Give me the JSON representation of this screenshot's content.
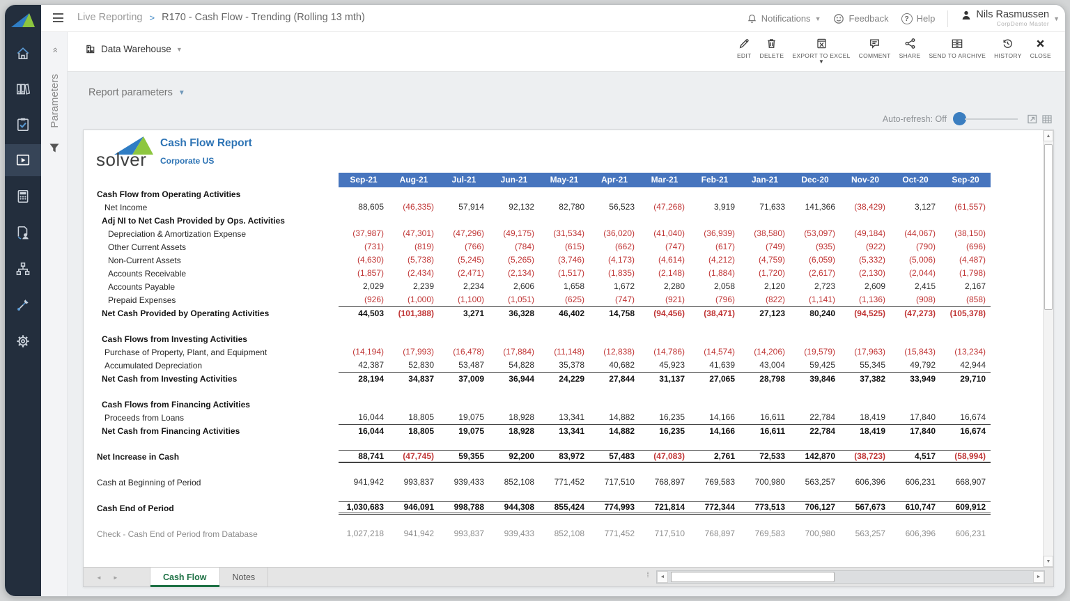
{
  "breadcrumb": {
    "section": "Live Reporting",
    "separator": ">",
    "title": "R170 - Cash Flow - Trending (Rolling 13 mth)"
  },
  "topbar": {
    "notifications": "Notifications",
    "feedback": "Feedback",
    "help": "Help",
    "user_name": "Nils Rasmussen",
    "user_role": "CorpDemo Master"
  },
  "sidebar": {
    "items": [
      {
        "icon": "home",
        "name": "home"
      },
      {
        "icon": "library",
        "name": "library"
      },
      {
        "icon": "tasks",
        "name": "tasks"
      },
      {
        "icon": "reporting",
        "name": "live-reporting",
        "active": true
      },
      {
        "icon": "calculator",
        "name": "budgeting"
      },
      {
        "icon": "dataentry",
        "name": "data-entry"
      },
      {
        "icon": "process",
        "name": "process"
      },
      {
        "icon": "tools",
        "name": "tools"
      },
      {
        "icon": "gear",
        "name": "settings"
      }
    ]
  },
  "params": {
    "strip_label": "Parameters",
    "expand_glyph": "»",
    "report_parameters": "Report parameters"
  },
  "toolband": {
    "source_label": "Data Warehouse",
    "actions": [
      {
        "label": "EDIT",
        "icon": "edit"
      },
      {
        "label": "DELETE",
        "icon": "trash"
      },
      {
        "label": "EXPORT TO EXCEL",
        "icon": "excel",
        "dropdown": true
      },
      {
        "label": "COMMENT",
        "icon": "comment"
      },
      {
        "label": "SHARE",
        "icon": "share"
      },
      {
        "label": "SEND TO ARCHIVE",
        "icon": "archive"
      },
      {
        "label": "HISTORY",
        "icon": "history"
      },
      {
        "label": "CLOSE",
        "icon": "close"
      }
    ]
  },
  "autorefresh": {
    "label": "Auto-refresh: Off"
  },
  "report": {
    "logo_text": "solver",
    "title": "Cash Flow Report",
    "subtitle": "Corporate US",
    "months": [
      "Sep-21",
      "Aug-21",
      "Jul-21",
      "Jun-21",
      "May-21",
      "Apr-21",
      "Mar-21",
      "Feb-21",
      "Jan-21",
      "Dec-20",
      "Nov-20",
      "Oct-20",
      "Sep-20"
    ],
    "rows": [
      {
        "label": "Cash Flow from Operating Activities",
        "bold": true,
        "indent": 0,
        "values": null
      },
      {
        "label": "Net Income",
        "indent": 11,
        "values": [
          "88,605",
          "(46,335)",
          "57,914",
          "92,132",
          "82,780",
          "56,523",
          "(47,268)",
          "3,919",
          "71,633",
          "141,366",
          "(38,429)",
          "3,127",
          "(61,557)"
        ]
      },
      {
        "label": "Adj NI to Net Cash Provided by Ops. Activities",
        "bold": true,
        "indent": 7,
        "values": null
      },
      {
        "label": "Depreciation & Amortization Expense",
        "indent": 16,
        "values": [
          "(37,987)",
          "(47,301)",
          "(47,296)",
          "(49,175)",
          "(31,534)",
          "(36,020)",
          "(41,040)",
          "(36,939)",
          "(38,580)",
          "(53,097)",
          "(49,184)",
          "(44,067)",
          "(38,150)"
        ]
      },
      {
        "label": "Other Current Assets",
        "indent": 16,
        "values": [
          "(731)",
          "(819)",
          "(766)",
          "(784)",
          "(615)",
          "(662)",
          "(747)",
          "(617)",
          "(749)",
          "(935)",
          "(922)",
          "(790)",
          "(696)"
        ]
      },
      {
        "label": "Non-Current Assets",
        "indent": 16,
        "values": [
          "(4,630)",
          "(5,738)",
          "(5,245)",
          "(5,265)",
          "(3,746)",
          "(4,173)",
          "(4,614)",
          "(4,212)",
          "(4,759)",
          "(6,059)",
          "(5,332)",
          "(5,006)",
          "(4,487)"
        ]
      },
      {
        "label": "Accounts Receivable",
        "indent": 16,
        "values": [
          "(1,857)",
          "(2,434)",
          "(2,471)",
          "(2,134)",
          "(1,517)",
          "(1,835)",
          "(2,148)",
          "(1,884)",
          "(1,720)",
          "(2,617)",
          "(2,130)",
          "(2,044)",
          "(1,798)"
        ]
      },
      {
        "label": "Accounts Payable",
        "indent": 16,
        "values": [
          "2,029",
          "2,239",
          "2,234",
          "2,606",
          "1,658",
          "1,672",
          "2,280",
          "2,058",
          "2,120",
          "2,723",
          "2,609",
          "2,415",
          "2,167"
        ]
      },
      {
        "label": "Prepaid Expenses",
        "indent": 16,
        "values": [
          "(926)",
          "(1,000)",
          "(1,100)",
          "(1,051)",
          "(625)",
          "(747)",
          "(921)",
          "(796)",
          "(822)",
          "(1,141)",
          "(1,136)",
          "(908)",
          "(858)"
        ]
      },
      {
        "label": "Net Cash Provided by Operating Activities",
        "bold": true,
        "indent": 7,
        "border": "top",
        "values": [
          "44,503",
          "(101,388)",
          "3,271",
          "36,328",
          "46,402",
          "14,758",
          "(94,456)",
          "(38,471)",
          "27,123",
          "80,240",
          "(94,525)",
          "(47,273)",
          "(105,378)"
        ]
      },
      {
        "spacer": true
      },
      {
        "label": "Cash Flows from Investing Activities",
        "bold": true,
        "indent": 7,
        "values": null
      },
      {
        "label": "Purchase of Property, Plant, and Equipment",
        "indent": 11,
        "values": [
          "(14,194)",
          "(17,993)",
          "(16,478)",
          "(17,884)",
          "(11,148)",
          "(12,838)",
          "(14,786)",
          "(14,574)",
          "(14,206)",
          "(19,579)",
          "(17,963)",
          "(15,843)",
          "(13,234)"
        ]
      },
      {
        "label": "Accumulated Depreciation",
        "indent": 11,
        "values": [
          "42,387",
          "52,830",
          "53,487",
          "54,828",
          "35,378",
          "40,682",
          "45,923",
          "41,639",
          "43,004",
          "59,425",
          "55,345",
          "49,792",
          "42,944"
        ]
      },
      {
        "label": "Net Cash from Investing Activities",
        "bold": true,
        "indent": 7,
        "border": "top",
        "values": [
          "28,194",
          "34,837",
          "37,009",
          "36,944",
          "24,229",
          "27,844",
          "31,137",
          "27,065",
          "28,798",
          "39,846",
          "37,382",
          "33,949",
          "29,710"
        ]
      },
      {
        "spacer": true
      },
      {
        "label": "Cash Flows from Financing Activities",
        "bold": true,
        "indent": 7,
        "values": null
      },
      {
        "label": "Proceeds from Loans",
        "indent": 11,
        "values": [
          "16,044",
          "18,805",
          "19,075",
          "18,928",
          "13,341",
          "14,882",
          "16,235",
          "14,166",
          "16,611",
          "22,784",
          "18,419",
          "17,840",
          "16,674"
        ]
      },
      {
        "label": "Net Cash from Financing Activities",
        "bold": true,
        "indent": 7,
        "border": "top",
        "values": [
          "16,044",
          "18,805",
          "19,075",
          "18,928",
          "13,341",
          "14,882",
          "16,235",
          "14,166",
          "16,611",
          "22,784",
          "18,419",
          "17,840",
          "16,674"
        ]
      },
      {
        "spacer": true
      },
      {
        "label": "Net Increase in Cash",
        "bold": true,
        "indent": 0,
        "border": "topbottom",
        "values": [
          "88,741",
          "(47,745)",
          "59,355",
          "92,200",
          "83,972",
          "57,483",
          "(47,083)",
          "2,761",
          "72,533",
          "142,870",
          "(38,723)",
          "4,517",
          "(58,994)"
        ]
      },
      {
        "spacer": true
      },
      {
        "label": "Cash at Beginning of Period",
        "indent": 0,
        "values": [
          "941,942",
          "993,837",
          "939,433",
          "852,108",
          "771,452",
          "717,510",
          "768,897",
          "769,583",
          "700,980",
          "563,257",
          "606,396",
          "606,231",
          "668,907"
        ]
      },
      {
        "spacer": true
      },
      {
        "label": "Cash End of Period",
        "bold": true,
        "indent": 0,
        "border": "topdouble",
        "values": [
          "1,030,683",
          "946,091",
          "998,788",
          "944,308",
          "855,424",
          "774,993",
          "721,814",
          "772,344",
          "773,513",
          "706,127",
          "567,673",
          "610,747",
          "609,912"
        ]
      },
      {
        "spacer": true
      },
      {
        "label": "Check - Cash End of Period from Database",
        "indent": 0,
        "gray": true,
        "values": [
          "1,027,218",
          "941,942",
          "993,837",
          "939,433",
          "852,108",
          "771,452",
          "717,510",
          "768,897",
          "769,583",
          "700,980",
          "563,257",
          "606,396",
          "606,231"
        ]
      }
    ]
  },
  "tabs": {
    "items": [
      "Cash Flow",
      "Notes"
    ],
    "active_index": 0
  },
  "colors": {
    "header_blue": "#4775be",
    "negative_red": "#c03535",
    "title_blue": "#2e74b5",
    "tab_green": "#1e7145",
    "sidebar_bg": "#232e3d"
  }
}
